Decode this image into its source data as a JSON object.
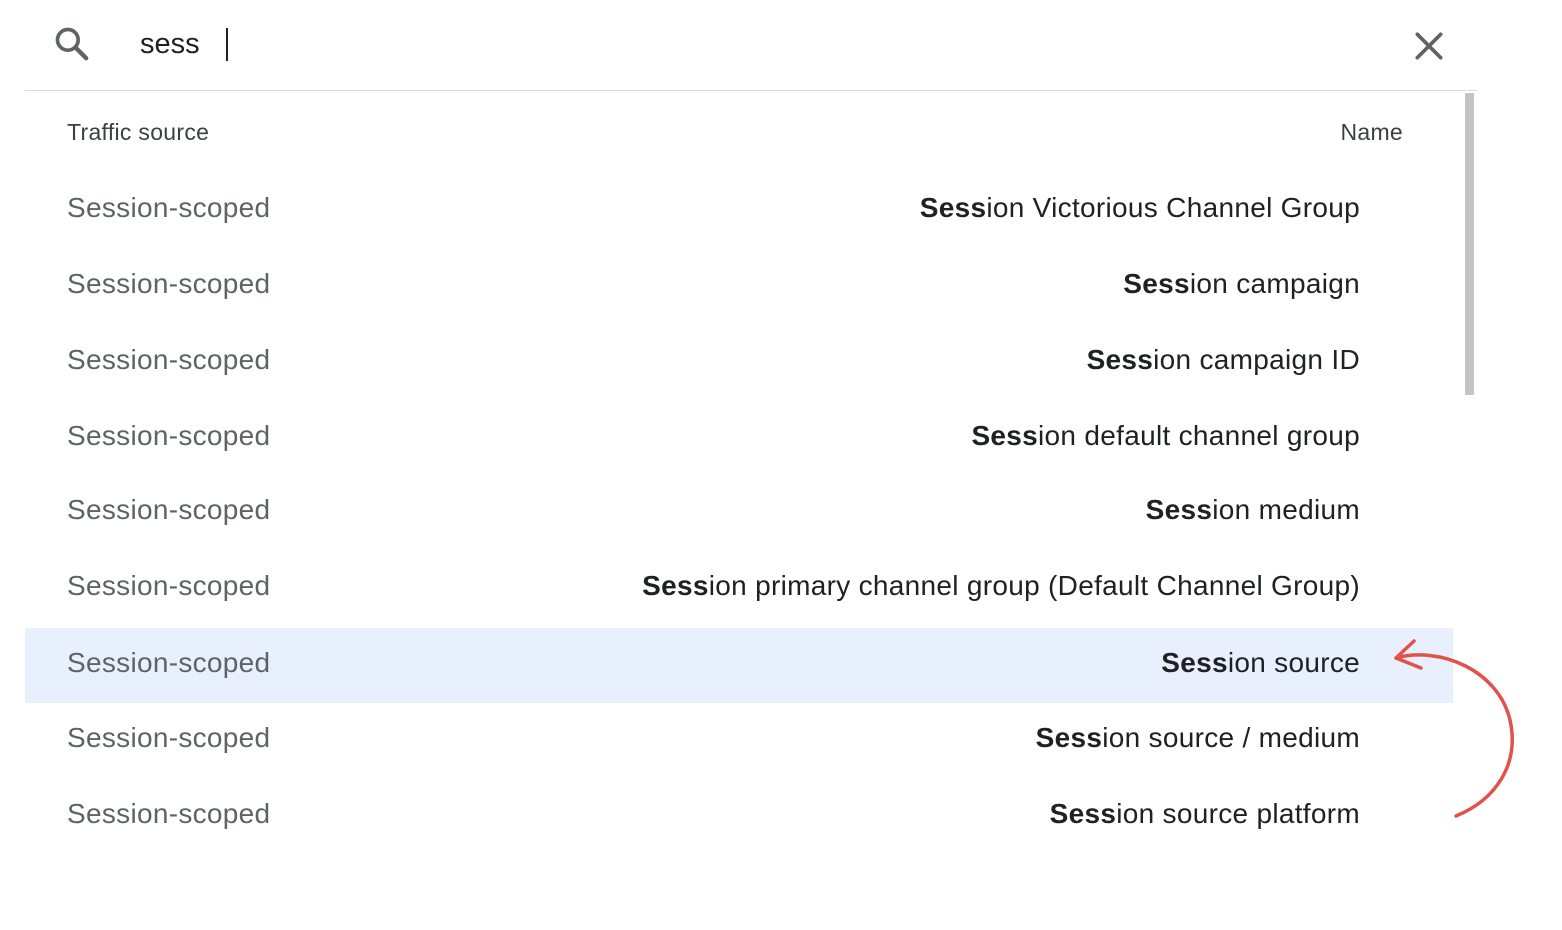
{
  "search": {
    "value": "sess",
    "placeholder": ""
  },
  "list": {
    "header": {
      "left": "Traffic source",
      "right": "Name"
    },
    "rows": [
      {
        "scope": "Session-scoped",
        "match": "Sess",
        "rest": "ion Victorious Channel Group",
        "selected": false
      },
      {
        "scope": "Session-scoped",
        "match": "Sess",
        "rest": "ion campaign",
        "selected": false
      },
      {
        "scope": "Session-scoped",
        "match": "Sess",
        "rest": "ion campaign ID",
        "selected": false
      },
      {
        "scope": "Session-scoped",
        "match": "Sess",
        "rest": "ion default channel group",
        "selected": false
      },
      {
        "scope": "Session-scoped",
        "match": "Sess",
        "rest": "ion medium",
        "selected": false
      },
      {
        "scope": "Session-scoped",
        "match": "Sess",
        "rest": "ion primary channel group (Default Channel Group)",
        "selected": false
      },
      {
        "scope": "Session-scoped",
        "match": "Sess",
        "rest": "ion source",
        "selected": true
      },
      {
        "scope": "Session-scoped",
        "match": "Sess",
        "rest": "ion source / medium",
        "selected": false
      },
      {
        "scope": "Session-scoped",
        "match": "Sess",
        "rest": "ion source platform",
        "selected": false
      }
    ]
  },
  "icons": {
    "search": "search-icon",
    "close": "close-icon",
    "annotation": "curved-arrow-icon"
  },
  "colors": {
    "selected_row": "#e8f0fe",
    "annotation_arrow": "#e0524a",
    "scrollbar_thumb": "#c4c4c4"
  }
}
